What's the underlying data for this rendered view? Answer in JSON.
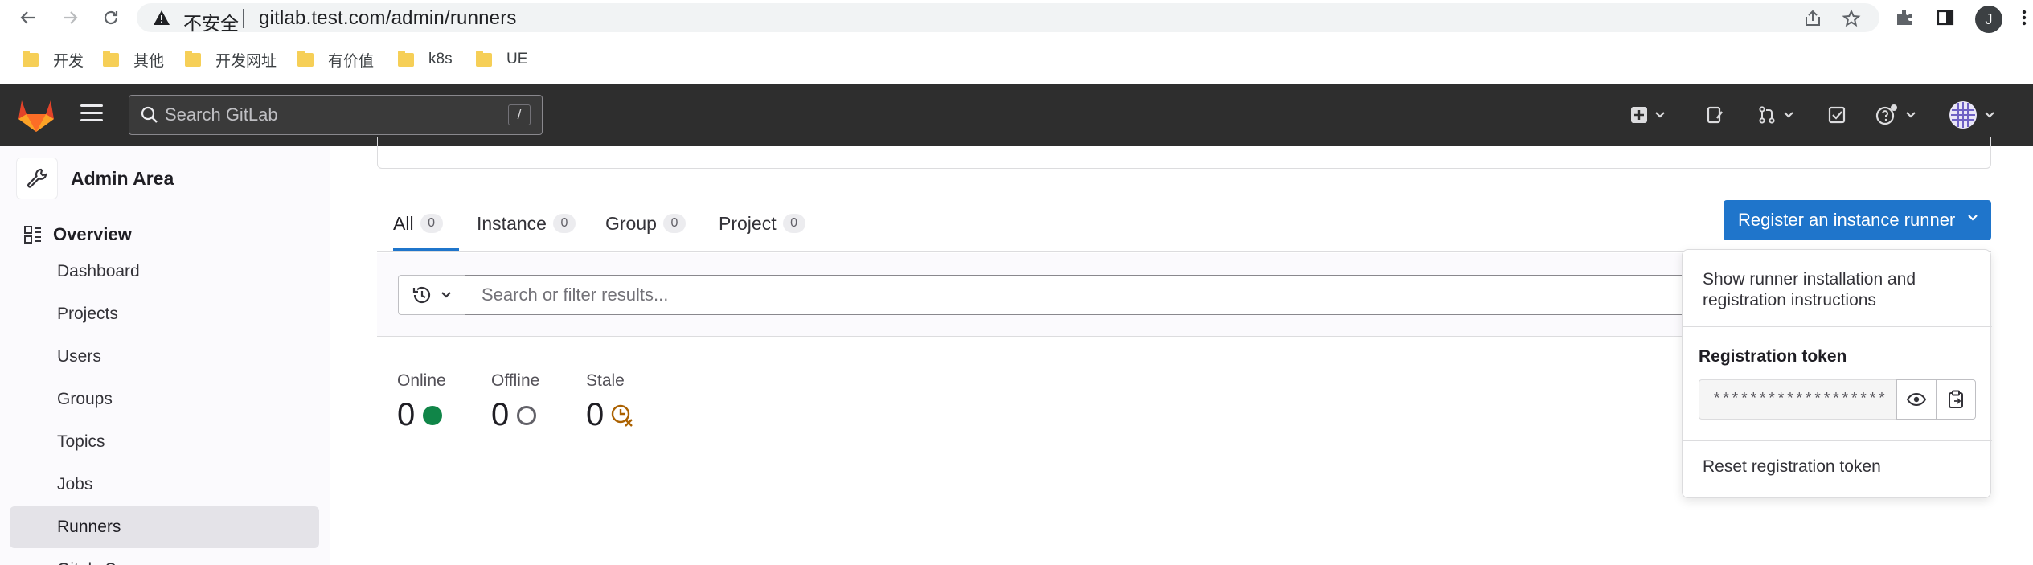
{
  "browser": {
    "security_label": "不安全",
    "url": "gitlab.test.com/admin/runners",
    "profile_initial": "J",
    "bookmarks": [
      "开发",
      "其他",
      "开发网址",
      "有价值",
      "k8s",
      "UE"
    ]
  },
  "topbar": {
    "search_placeholder": "Search GitLab",
    "search_shortcut": "/"
  },
  "sidebar": {
    "title": "Admin Area",
    "overview_label": "Overview",
    "items": [
      "Dashboard",
      "Projects",
      "Users",
      "Groups",
      "Topics",
      "Jobs",
      "Runners",
      "Gitaly Servers"
    ],
    "active_item": "Runners"
  },
  "tabs": [
    {
      "label": "All",
      "count": "0"
    },
    {
      "label": "Instance",
      "count": "0"
    },
    {
      "label": "Group",
      "count": "0"
    },
    {
      "label": "Project",
      "count": "0"
    }
  ],
  "register_button": "Register an instance runner",
  "filter": {
    "placeholder": "Search or filter results..."
  },
  "stats": [
    {
      "label": "Online",
      "value": "0"
    },
    {
      "label": "Offline",
      "value": "0"
    },
    {
      "label": "Stale",
      "value": "0"
    }
  ],
  "dropdown": {
    "show_instructions": "Show runner installation and registration instructions",
    "token_title": "Registration token",
    "token_masked": "*******************",
    "reset_label": "Reset registration token"
  },
  "colors": {
    "topbar": "#2e2e2e",
    "primary": "#1f75cb",
    "online": "#108548",
    "stale": "#ab6100"
  }
}
